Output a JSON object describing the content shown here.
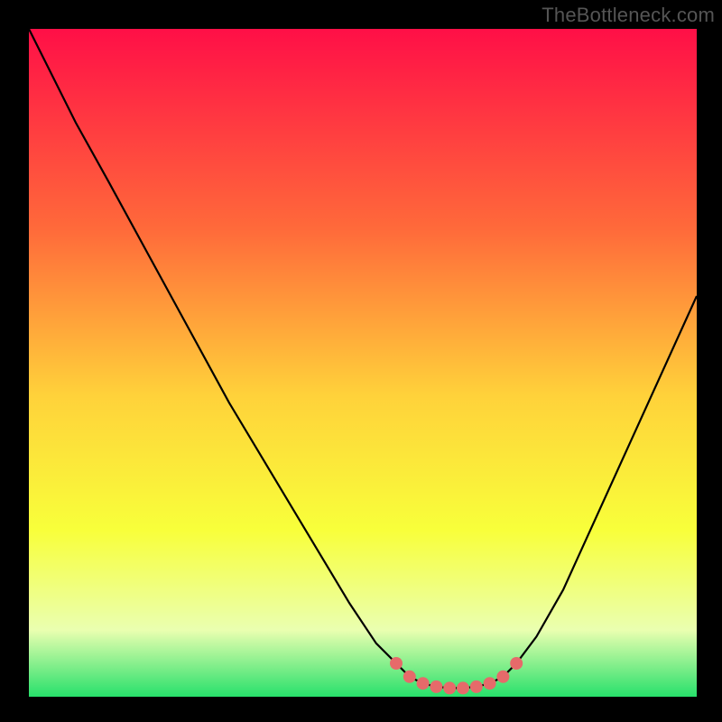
{
  "watermark": "TheBottleneck.com",
  "colors": {
    "bg": "#000000",
    "curve": "#000000",
    "marker": "#e66a6a",
    "grad_top": "#ff0f47",
    "grad_mid1": "#ff6a3a",
    "grad_mid2": "#ffd23a",
    "grad_mid3": "#f8ff3a",
    "grad_bottom_pale": "#eaffb0",
    "grad_bottom_green": "#27e06b"
  },
  "chart_data": {
    "type": "line",
    "title": "",
    "xlabel": "",
    "ylabel": "",
    "xlim": [
      0,
      100
    ],
    "ylim": [
      0,
      100
    ],
    "grid": false,
    "series": [
      {
        "name": "bottleneck-curve",
        "x": [
          0,
          3,
          7,
          12,
          18,
          24,
          30,
          36,
          42,
          48,
          52,
          55,
          57,
          59,
          61,
          63,
          65,
          67,
          69,
          71,
          73,
          76,
          80,
          85,
          90,
          95,
          100
        ],
        "y": [
          100,
          94,
          86,
          77,
          66,
          55,
          44,
          34,
          24,
          14,
          8,
          5,
          3,
          2,
          1.5,
          1.3,
          1.3,
          1.5,
          2,
          3,
          5,
          9,
          16,
          27,
          38,
          49,
          60
        ]
      }
    ],
    "markers": {
      "name": "highlight-dots",
      "x": [
        55,
        57,
        59,
        61,
        63,
        65,
        67,
        69,
        71,
        73
      ],
      "y": [
        5,
        3,
        2,
        1.5,
        1.3,
        1.3,
        1.5,
        2,
        3,
        5
      ]
    }
  }
}
